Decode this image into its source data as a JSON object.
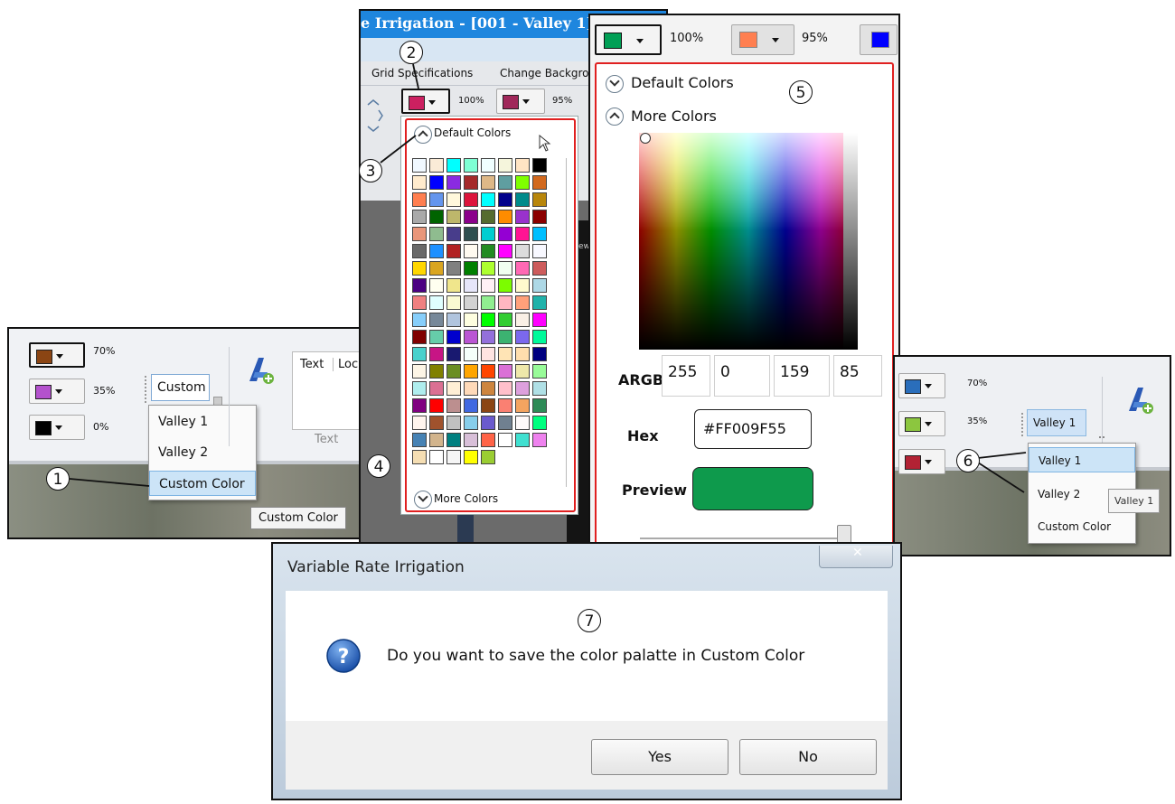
{
  "panel1": {
    "rows": [
      {
        "color": "#8b4513",
        "pct": "70%"
      },
      {
        "color": "#b452cd",
        "pct": "35%"
      },
      {
        "color": "#000000",
        "pct": "0%"
      }
    ],
    "combo_value": "Custom",
    "dropdown_items": [
      "Valley 1",
      "Valley 2",
      "Custom Color"
    ],
    "tooltip": "Custom Color",
    "text_group": {
      "col1": "Text",
      "col2": "Loc",
      "caption": "Text"
    }
  },
  "panel2": {
    "title": "e Irrigation - [001 - Valley 1]",
    "menu": [
      "Grid Specifications",
      "Change Backgrou"
    ],
    "swatches": [
      {
        "color": "#cc2060",
        "pct": "100%"
      },
      {
        "color": "#a0285a",
        "pct": "95%"
      }
    ],
    "default_colors_label": "Default Colors",
    "more_colors_label": "More Colors",
    "side_text": "ew",
    "palette": [
      "#f0f8ff",
      "#faebd7",
      "#00ffff",
      "#7fffd4",
      "#f0ffff",
      "#f5f5dc",
      "#ffe4c4",
      "#000000",
      "#ffebcd",
      "#0000ff",
      "#8a2be2",
      "#a52a2a",
      "#deb887",
      "#5f9ea0",
      "#7fff00",
      "#d2691e",
      "#ff7f50",
      "#6495ed",
      "#fff8dc",
      "#dc143c",
      "#00ffff",
      "#00008b",
      "#008b8b",
      "#b8860b",
      "#a9a9a9",
      "#006400",
      "#bdb76b",
      "#8b008b",
      "#556b2f",
      "#ff8c00",
      "#9932cc",
      "#8b0000",
      "#e9967a",
      "#8fbc8f",
      "#483d8b",
      "#2f4f4f",
      "#00ced1",
      "#9400d3",
      "#ff1493",
      "#00bfff",
      "#696969",
      "#1e90ff",
      "#b22222",
      "#fffaf0",
      "#228b22",
      "#ff00ff",
      "#dcdcdc",
      "#f8f8ff",
      "#ffd700",
      "#daa520",
      "#808080",
      "#008000",
      "#adff2f",
      "#f0fff0",
      "#ff69b4",
      "#cd5c5c",
      "#4b0082",
      "#fffff0",
      "#f0e68c",
      "#e6e6fa",
      "#fff0f5",
      "#7cfc00",
      "#fffacd",
      "#add8e6",
      "#f08080",
      "#e0ffff",
      "#fafad2",
      "#d3d3d3",
      "#90ee90",
      "#ffb6c1",
      "#ffa07a",
      "#20b2aa",
      "#87cefa",
      "#778899",
      "#b0c4de",
      "#ffffe0",
      "#00ff00",
      "#32cd32",
      "#faf0e6",
      "#ff00ff",
      "#800000",
      "#66cdaa",
      "#0000cd",
      "#ba55d3",
      "#9370db",
      "#3cb371",
      "#7b68ee",
      "#00fa9a",
      "#48d1cc",
      "#c71585",
      "#191970",
      "#f5fffa",
      "#ffe4e1",
      "#ffe4b5",
      "#ffdead",
      "#000080",
      "#fdf5e6",
      "#808000",
      "#6b8e23",
      "#ffa500",
      "#ff4500",
      "#da70d6",
      "#eee8aa",
      "#98fb98",
      "#afeeee",
      "#db7093",
      "#ffefd5",
      "#ffdab9",
      "#cd853f",
      "#ffc0cb",
      "#dda0dd",
      "#b0e0e6",
      "#800080",
      "#ff0000",
      "#bc8f8f",
      "#4169e1",
      "#8b4513",
      "#fa8072",
      "#f4a460",
      "#2e8b57",
      "#fff5ee",
      "#a0522d",
      "#c0c0c0",
      "#87ceeb",
      "#6a5acd",
      "#708090",
      "#fffafa",
      "#00ff7f",
      "#4682b4",
      "#d2b48c",
      "#008080",
      "#d8bfd8",
      "#ff6347",
      "#ffffff",
      "#40e0d0",
      "#ee82ee",
      "#f5deb3",
      "#ffffff",
      "#f5f5f5",
      "#ffff00",
      "#9acd32"
    ]
  },
  "panel3": {
    "swatches": [
      {
        "color": "#009f55",
        "pct": "100%"
      },
      {
        "color": "#ff7f50",
        "pct": "95%"
      },
      {
        "color": "#0000ff"
      }
    ],
    "default_colors_label": "Default Colors",
    "more_colors_label": "More Colors",
    "argb_label": "ARGB",
    "argb": [
      "255",
      "0",
      "159",
      "85"
    ],
    "hex_label": "Hex",
    "hex_value": "#FF009F55",
    "preview_label": "Preview",
    "preview_color": "#0e9a4c"
  },
  "panel4": {
    "rows": [
      {
        "color": "#2a6ebb",
        "pct": "70%"
      },
      {
        "color": "#8cc63f",
        "pct": "35%"
      },
      {
        "color": "#b22234"
      }
    ],
    "combo_value": "Valley 1",
    "dropdown_items": [
      "Valley 1",
      "Valley 2",
      "Custom Color"
    ],
    "tooltip": "Valley 1"
  },
  "dialog": {
    "title": "Variable Rate Irrigation",
    "message": "Do you want to save the color palatte in Custom Color",
    "yes": "Yes",
    "no": "No"
  },
  "callouts": [
    "1",
    "2",
    "3",
    "4",
    "5",
    "6",
    "7"
  ]
}
